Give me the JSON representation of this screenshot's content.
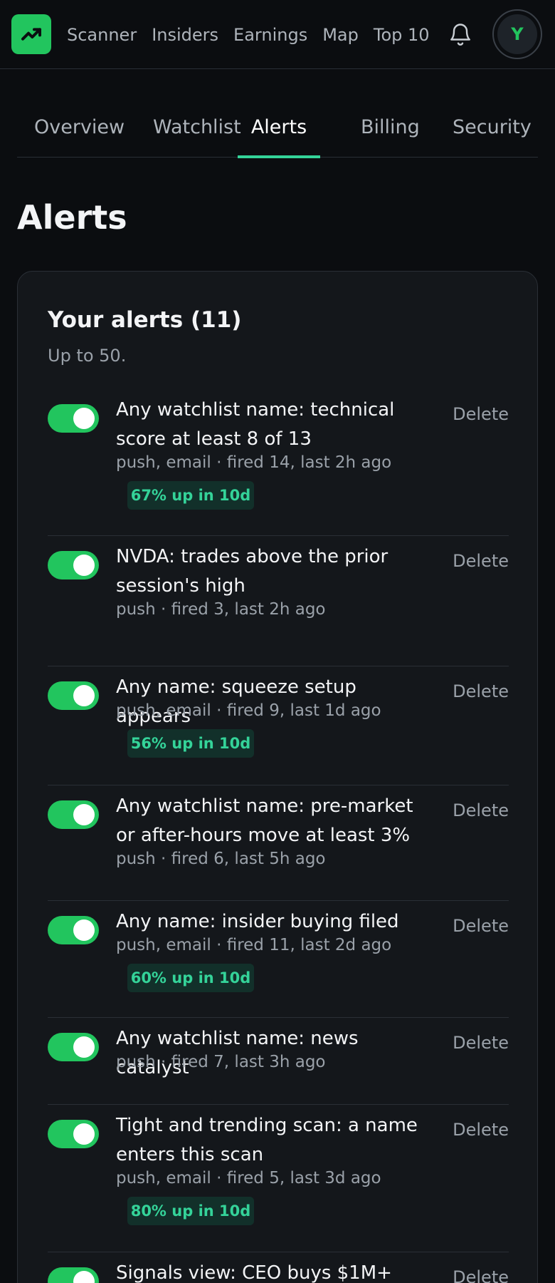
{
  "nav": {
    "links": [
      "Scanner",
      "Insiders",
      "Earnings",
      "Map",
      "Top 10"
    ],
    "avatar_initial": "Y"
  },
  "tabs": [
    "Overview",
    "Watchlist",
    "Alerts",
    "Billing",
    "Security"
  ],
  "active_tab": "Alerts",
  "page_title": "Alerts",
  "card": {
    "title": "Your alerts (11)",
    "subtitle": "Up to 50."
  },
  "alerts": [
    {
      "text": "Any watchlist name: technical score at least 8 of 13",
      "meta": "push, email · fired 14, last 2h ago",
      "badge": "67% up in 10d",
      "enabled": true,
      "delete_label": "Delete"
    },
    {
      "text": "NVDA: trades above the prior session's high",
      "meta": "push · fired 3, last 2h ago",
      "badge": "",
      "enabled": true,
      "delete_label": "Delete"
    },
    {
      "text": "Any name: squeeze setup appears",
      "meta": "push, email · fired 9, last 1d ago",
      "badge": "56% up in 10d",
      "enabled": true,
      "delete_label": "Delete"
    },
    {
      "text": "Any watchlist name: pre-market or after-hours move at least 3%",
      "meta": "push · fired 6, last 5h ago",
      "badge": "",
      "enabled": true,
      "delete_label": "Delete"
    },
    {
      "text": "Any name: insider buying filed",
      "meta": "push, email · fired 11, last 2d ago",
      "badge": "60% up in 10d",
      "enabled": true,
      "delete_label": "Delete"
    },
    {
      "text": "Any watchlist name: news catalyst",
      "meta": "push · fired 7, last 3h ago",
      "badge": "",
      "enabled": true,
      "delete_label": "Delete"
    },
    {
      "text": "Tight and trending scan: a name enters this scan",
      "meta": "push, email · fired 5, last 3d ago",
      "badge": "80% up in 10d",
      "enabled": true,
      "delete_label": "Delete"
    },
    {
      "text": "Signals view: CEO buys $1M+",
      "meta": "",
      "badge": "",
      "enabled": true,
      "delete_label": "Delete"
    }
  ],
  "colors": {
    "accent": "#22c55e",
    "accent_text": "#34d399",
    "background": "#0b0d10",
    "card": "#14171b"
  }
}
